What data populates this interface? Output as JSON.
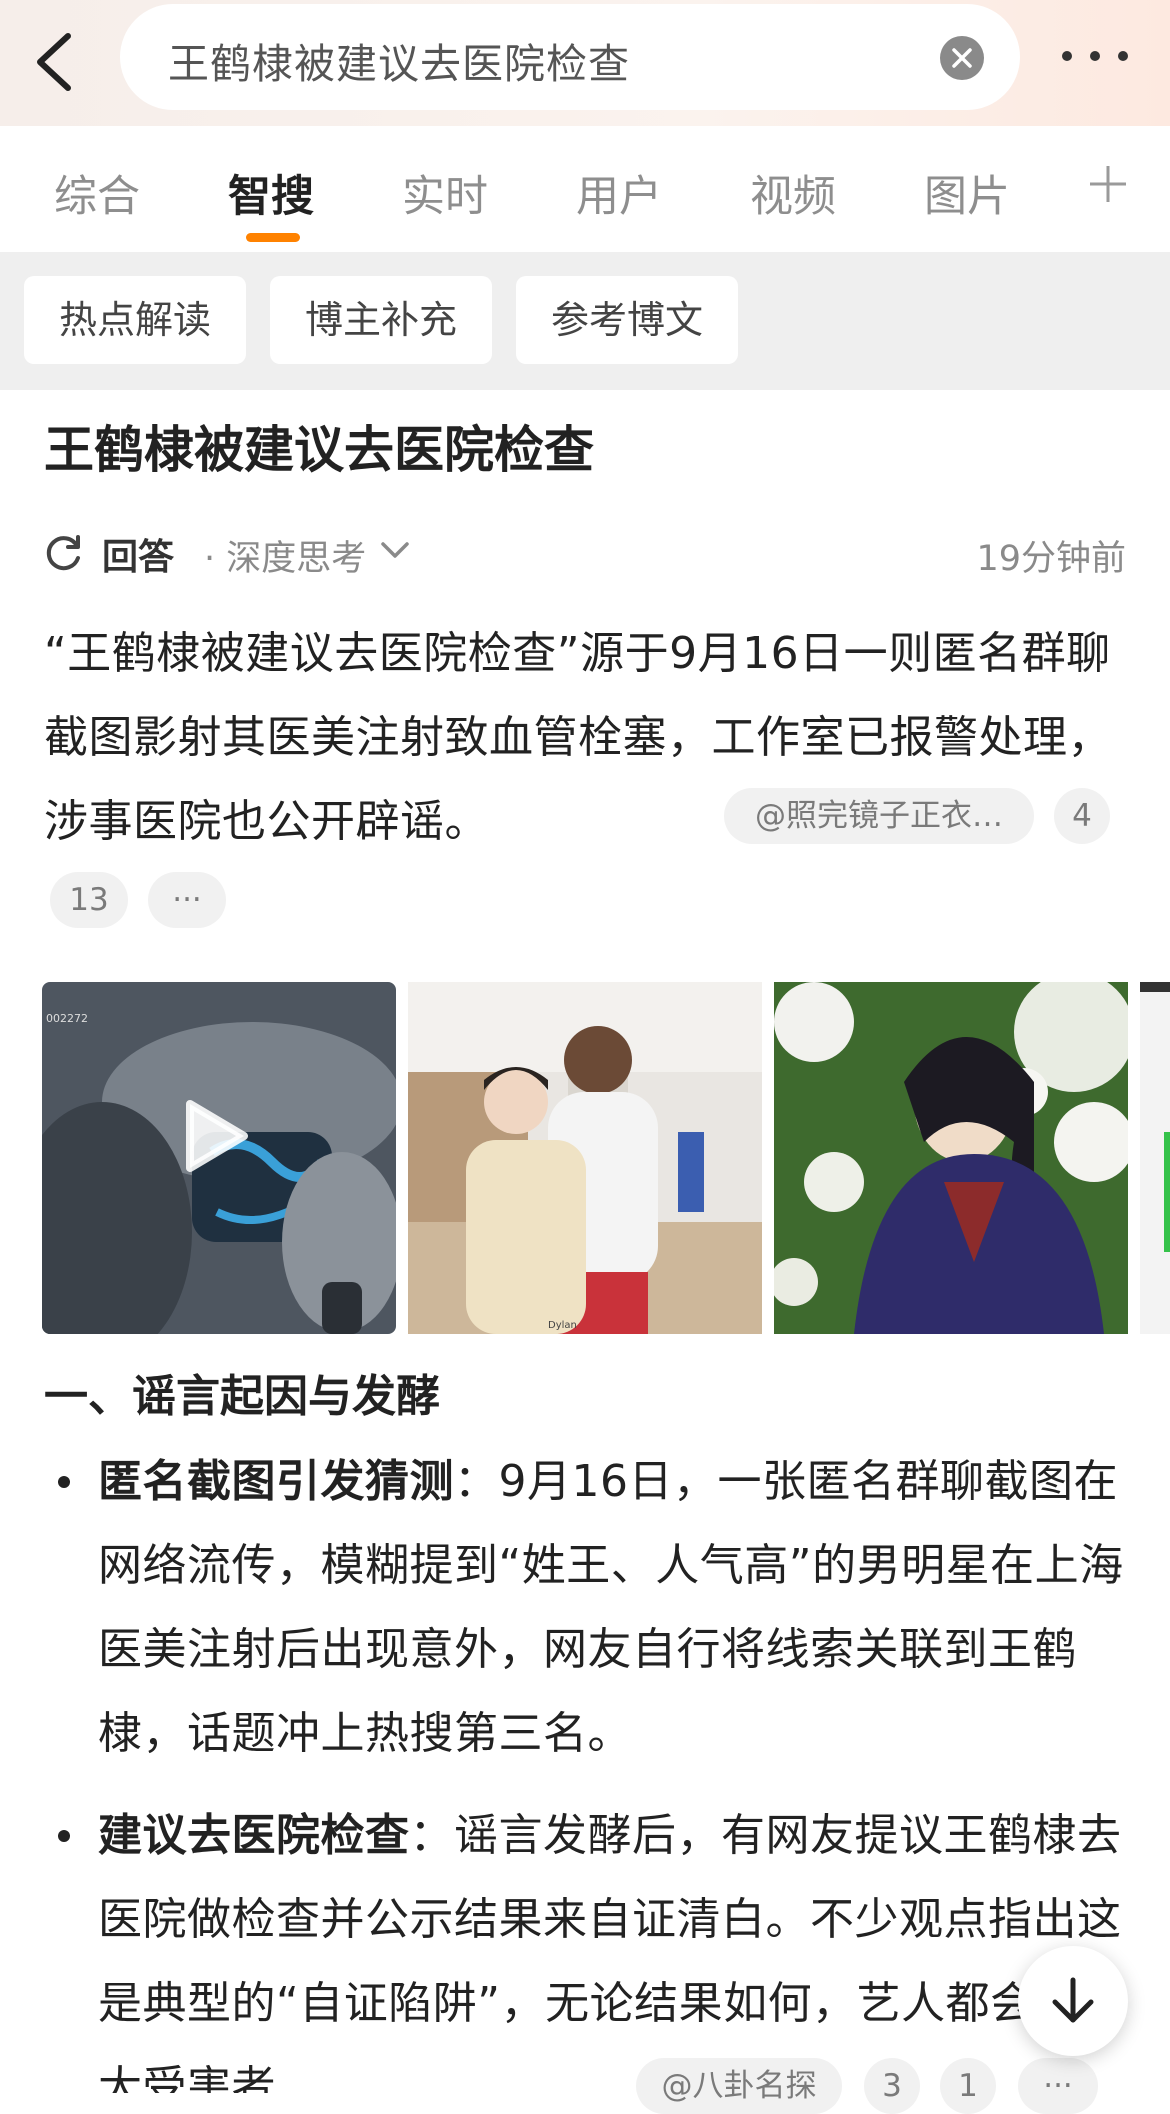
{
  "search": {
    "query": "王鹤棣被建议去医院检查"
  },
  "tabs": [
    {
      "label": "综合"
    },
    {
      "label": "智搜"
    },
    {
      "label": "实时"
    },
    {
      "label": "用户"
    },
    {
      "label": "视频"
    },
    {
      "label": "图片"
    }
  ],
  "active_tab": "智搜",
  "chips": [
    {
      "label": "热点解读"
    },
    {
      "label": "博主补充"
    },
    {
      "label": "参考博文"
    }
  ],
  "article": {
    "headline": "王鹤棣被建议去医院检查",
    "answer_label": "回答",
    "answer_mode": "· 深度思考",
    "timestamp": "19分钟前",
    "summary": "“王鹤棣被建议去医院检查”源于9月16日一则匿名群聊截图影射其医美注射致血管栓塞，工作室已报警处理，涉事医院也公开辟谣。",
    "source_pill": "@照完镜子正衣…",
    "ref_pills": [
      "4",
      "13"
    ],
    "more_pill": "···"
  },
  "images": [
    {
      "name": "video-thumbnail",
      "caption": "002272",
      "is_video": true
    },
    {
      "name": "photo-basketball-court",
      "caption": "Dylan"
    },
    {
      "name": "photo-blossom-costume"
    }
  ],
  "section": {
    "title": "一、谣言起因与发酵",
    "bullets": [
      {
        "bold": "匿名截图引发猜测",
        "text": "：9月16日，一张匿名群聊截图在网络流传，模糊提到“姓王、人气高”的男明星在上海医美注射后出现意外，网友自行将线索关联到王鹤棣，话题冲上热搜第三名。"
      },
      {
        "bold": "建议去医院检查",
        "text": "：谣言发酵后，有网友提议王鹤棣去医院做检查并公示结果来自证清白。不少观点指出这是典型的“自证陷阱”，无论结果如何，艺人都会是最大受害者",
        "source_pill": "@八卦名探",
        "ref_pills": [
          "3",
          "1"
        ],
        "more_pill": "···"
      }
    ]
  },
  "colors": {
    "accent": "#ff8200",
    "chip_bar_bg": "#efefef",
    "muted_text": "#8a8a8a"
  }
}
